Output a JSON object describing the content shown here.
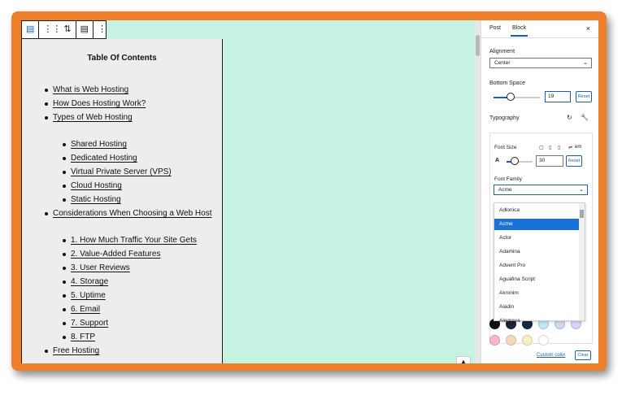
{
  "colors": {
    "frame": "#ee7f2d",
    "canvas": "#c6f2e1",
    "toc_bg": "#ededed",
    "accent": "#1a5fb4",
    "selected_option": "#1a72d8"
  },
  "toolbar": {
    "icons": [
      "table-of-contents-icon",
      "drag-handle-icon",
      "move-up-down-icon",
      "align-icon",
      "more-options-icon"
    ]
  },
  "toc": {
    "title": "Table Of Contents",
    "items": [
      {
        "label": "What is Web Hosting",
        "level": 1
      },
      {
        "label": "How Does Hosting Work?",
        "level": 1
      },
      {
        "label": "Types of Web Hosting",
        "level": 1
      },
      {
        "label": "Shared Hosting",
        "level": 2
      },
      {
        "label": "Dedicated Hosting",
        "level": 2
      },
      {
        "label": "Virtual Private Server (VPS)",
        "level": 2
      },
      {
        "label": "Cloud Hosting",
        "level": 2
      },
      {
        "label": "Static Hosting",
        "level": 2
      },
      {
        "label": "Considerations When Choosing a Web Host",
        "level": 1
      },
      {
        "label": "1. How Much Traffic Your Site Gets",
        "level": 2
      },
      {
        "label": "2. Value-Added Features",
        "level": 2
      },
      {
        "label": "3. User Reviews",
        "level": 2
      },
      {
        "label": "4. Storage",
        "level": 2
      },
      {
        "label": "5. Uptime",
        "level": 2
      },
      {
        "label": "6. Email",
        "level": 2
      },
      {
        "label": "7. Support",
        "level": 2
      },
      {
        "label": "8. FTP",
        "level": 2
      },
      {
        "label": "Free Hosting",
        "level": 1
      }
    ]
  },
  "sidebar": {
    "tabs": [
      "Post",
      "Block"
    ],
    "active_tab": "Block",
    "close": "×",
    "alignment": {
      "label": "Alignment",
      "value": "Center"
    },
    "bottom_space": {
      "label": "Bottom Space",
      "value": "19",
      "reset": "Reset",
      "slider_fraction": 0.25
    },
    "typography": {
      "label": "Typography"
    },
    "font_size": {
      "label": "Font Size",
      "units": "em",
      "size_icon": "A",
      "value": "30",
      "reset": "Reset",
      "slider_fraction": 0.25
    },
    "font_family": {
      "label": "Font Family",
      "value": "Acme",
      "options": [
        "Adlonica",
        "Acme",
        "Actor",
        "Adamina",
        "Advent Pro",
        "Aguafina Script",
        "Akronim",
        "Aladin",
        "Alegreya"
      ],
      "selected": "Acme"
    },
    "colors": {
      "swatches": [
        "#111111",
        "#1c2438",
        "#152a4a",
        "#bfe7f7",
        "#ccd9f5",
        "#d9d4f7",
        "#f7b8c8",
        "#f6d9b8",
        "#f8efc6",
        "#ffffff"
      ],
      "custom_color": "Custom color",
      "clear": "Clear"
    }
  }
}
